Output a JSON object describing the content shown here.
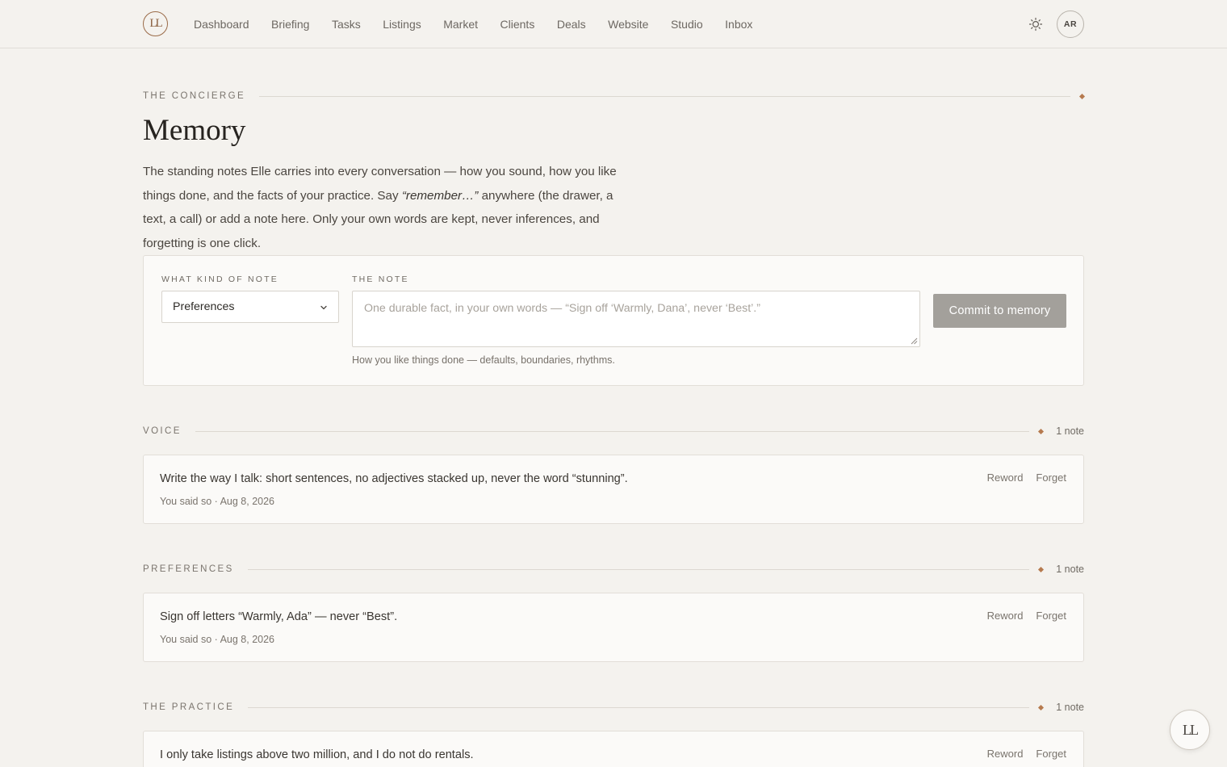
{
  "header": {
    "logo_text": "LL",
    "nav": [
      "Dashboard",
      "Briefing",
      "Tasks",
      "Listings",
      "Market",
      "Clients",
      "Deals",
      "Website",
      "Studio",
      "Inbox"
    ],
    "avatar_initials": "AR",
    "theme_icon": "sun-icon"
  },
  "page": {
    "eyebrow": "THE CONCIERGE",
    "title": "Memory",
    "intro_before": "The standing notes Elle carries into every conversation — how you sound, how you like things done, and the facts of your practice. Say ",
    "intro_em": "“remember…”",
    "intro_after": " anywhere (the drawer, a text, a call) or add a note here. Only your own words are kept, never inferences, and forgetting is one click."
  },
  "form": {
    "kind_label": "WHAT KIND OF NOTE",
    "kind_value": "Preferences",
    "note_label": "THE NOTE",
    "note_value": "",
    "note_placeholder": "One durable fact, in your own words — “Sign off ‘Warmly, Dana’, never ‘Best’.”",
    "hint": "How you like things done — defaults, boundaries, rhythms.",
    "commit_label": "Commit to memory"
  },
  "sections": [
    {
      "label": "VOICE",
      "count": "1 note",
      "notes": [
        {
          "text": "Write the way I talk: short sentences, no adjectives stacked up, never the word “stunning”.",
          "meta": "You said so · Aug 8, 2026"
        }
      ]
    },
    {
      "label": "PREFERENCES",
      "count": "1 note",
      "notes": [
        {
          "text": "Sign off letters “Warmly, Ada” — never “Best”.",
          "meta": "You said so · Aug 8, 2026"
        }
      ]
    },
    {
      "label": "THE PRACTICE",
      "count": "1 note",
      "notes": [
        {
          "text": "I only take listings above two million, and I do not do rentals.",
          "meta": ""
        }
      ]
    }
  ],
  "actions": {
    "reword": "Reword",
    "forget": "Forget"
  },
  "fab_text": "LL",
  "colors": {
    "accent": "#b67a4e",
    "background": "#f4f2ee",
    "card": "#fbfaf8",
    "button_disabled": "#a3a09b"
  }
}
